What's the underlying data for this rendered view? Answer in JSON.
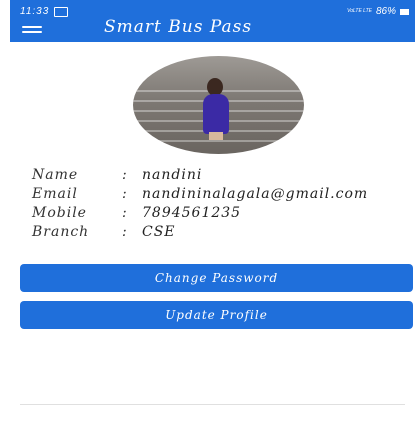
{
  "status_bar": {
    "time": "11:33",
    "network": "VoLTE LTE",
    "battery": "86%"
  },
  "app_bar": {
    "title": "Smart Bus Pass"
  },
  "profile": {
    "fields": [
      {
        "label": "Name",
        "value": "nandini"
      },
      {
        "label": "Email",
        "value": "nandininalagala@gmail.com"
      },
      {
        "label": "Mobile",
        "value": "7894561235"
      },
      {
        "label": "Branch",
        "value": "CSE"
      }
    ]
  },
  "buttons": {
    "change_password": "Change Password",
    "update_profile": "Update Profile"
  },
  "colors": {
    "primary": "#1f6fdb"
  }
}
